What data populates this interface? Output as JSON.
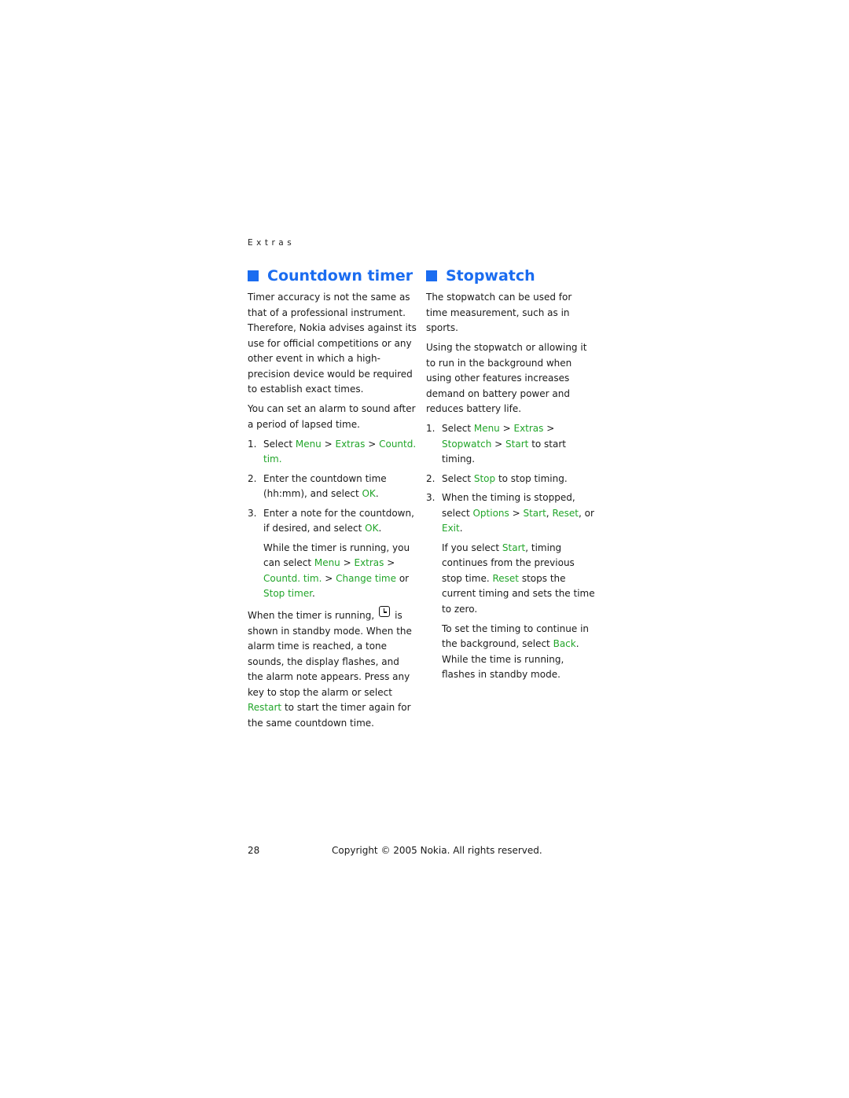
{
  "header": {
    "section": "Extras"
  },
  "countdown": {
    "title": "Countdown timer",
    "p1": "Timer accuracy is not the same as that of a professional instrument. Therefore, Nokia advises against its use for official competitions or any other event in which a high-precision device would be required to establish exact times.",
    "p2": "You can set an alarm to sound after a period of lapsed time.",
    "steps": [
      {
        "num": "1.",
        "pre": "Select ",
        "menu": "Menu",
        "sep1": " > ",
        "extras": "Extras",
        "sep2": " > ",
        "item": "Countd. tim.",
        "post": ""
      },
      {
        "num": "2.",
        "pre": "Enter the countdown time (hh:mm), and select ",
        "ok": "OK",
        "post": "."
      },
      {
        "num": "3.",
        "pre": "Enter a note for the countdown, if desired, and select ",
        "ok": "OK",
        "post": "."
      }
    ],
    "note": {
      "pre": "While the timer is running, you can select ",
      "menu": "Menu",
      "sep1": " > ",
      "extras": "Extras",
      "sep2": " > ",
      "item": "Countd. tim.",
      "sep3": " > ",
      "change": "Change time",
      "or": " or ",
      "stop": "Stop timer",
      "post": "."
    },
    "running": {
      "pre": "When the timer is running,",
      "icon": "timer-clock-icon",
      "post": "is shown in standby mode. When the alarm time is reached, a tone sounds, the display flashes, and the alarm note appears. Press any key to stop the alarm or select ",
      "restart": "Restart",
      "end": " to start the timer again for the same countdown time."
    }
  },
  "stopwatch": {
    "title": "Stopwatch",
    "p1": "The stopwatch can be used for time measurement, such as in sports.",
    "p2": "Using the stopwatch or allowing it to run in the background when using other features increases demand on battery power and reduces battery life.",
    "step1": {
      "num": "1.",
      "pre": "Select ",
      "menu": "Menu",
      "sep1": " > ",
      "extras": "Extras",
      "sep2": " > ",
      "stopwatch": "Stopwatch",
      "sep3": " > ",
      "start": "Start",
      "post": " to start timing."
    },
    "step2": {
      "num": "2.",
      "pre": "Select ",
      "stop": "Stop",
      "post": " to stop timing."
    },
    "step3": {
      "num": "3.",
      "pre": "When the timing is stopped, select ",
      "options": "Options",
      "sep": " > ",
      "start": "Start",
      "comma": ", ",
      "reset": "Reset",
      "or": ", or ",
      "exit": "Exit",
      "post": "."
    },
    "note1": {
      "pre": "If you select ",
      "start": "Start",
      "mid": ", timing continues from the previous stop time. ",
      "reset": "Reset",
      "post": " stops the current timing and sets the time to zero."
    },
    "note2": {
      "pre": "To set the timing to continue in the background, select ",
      "back": "Back",
      "mid": ". While the time is running,",
      "post": "flashes in standby mode."
    }
  },
  "footer": {
    "page": "28",
    "copyright": "Copyright © 2005 Nokia. All rights reserved."
  }
}
